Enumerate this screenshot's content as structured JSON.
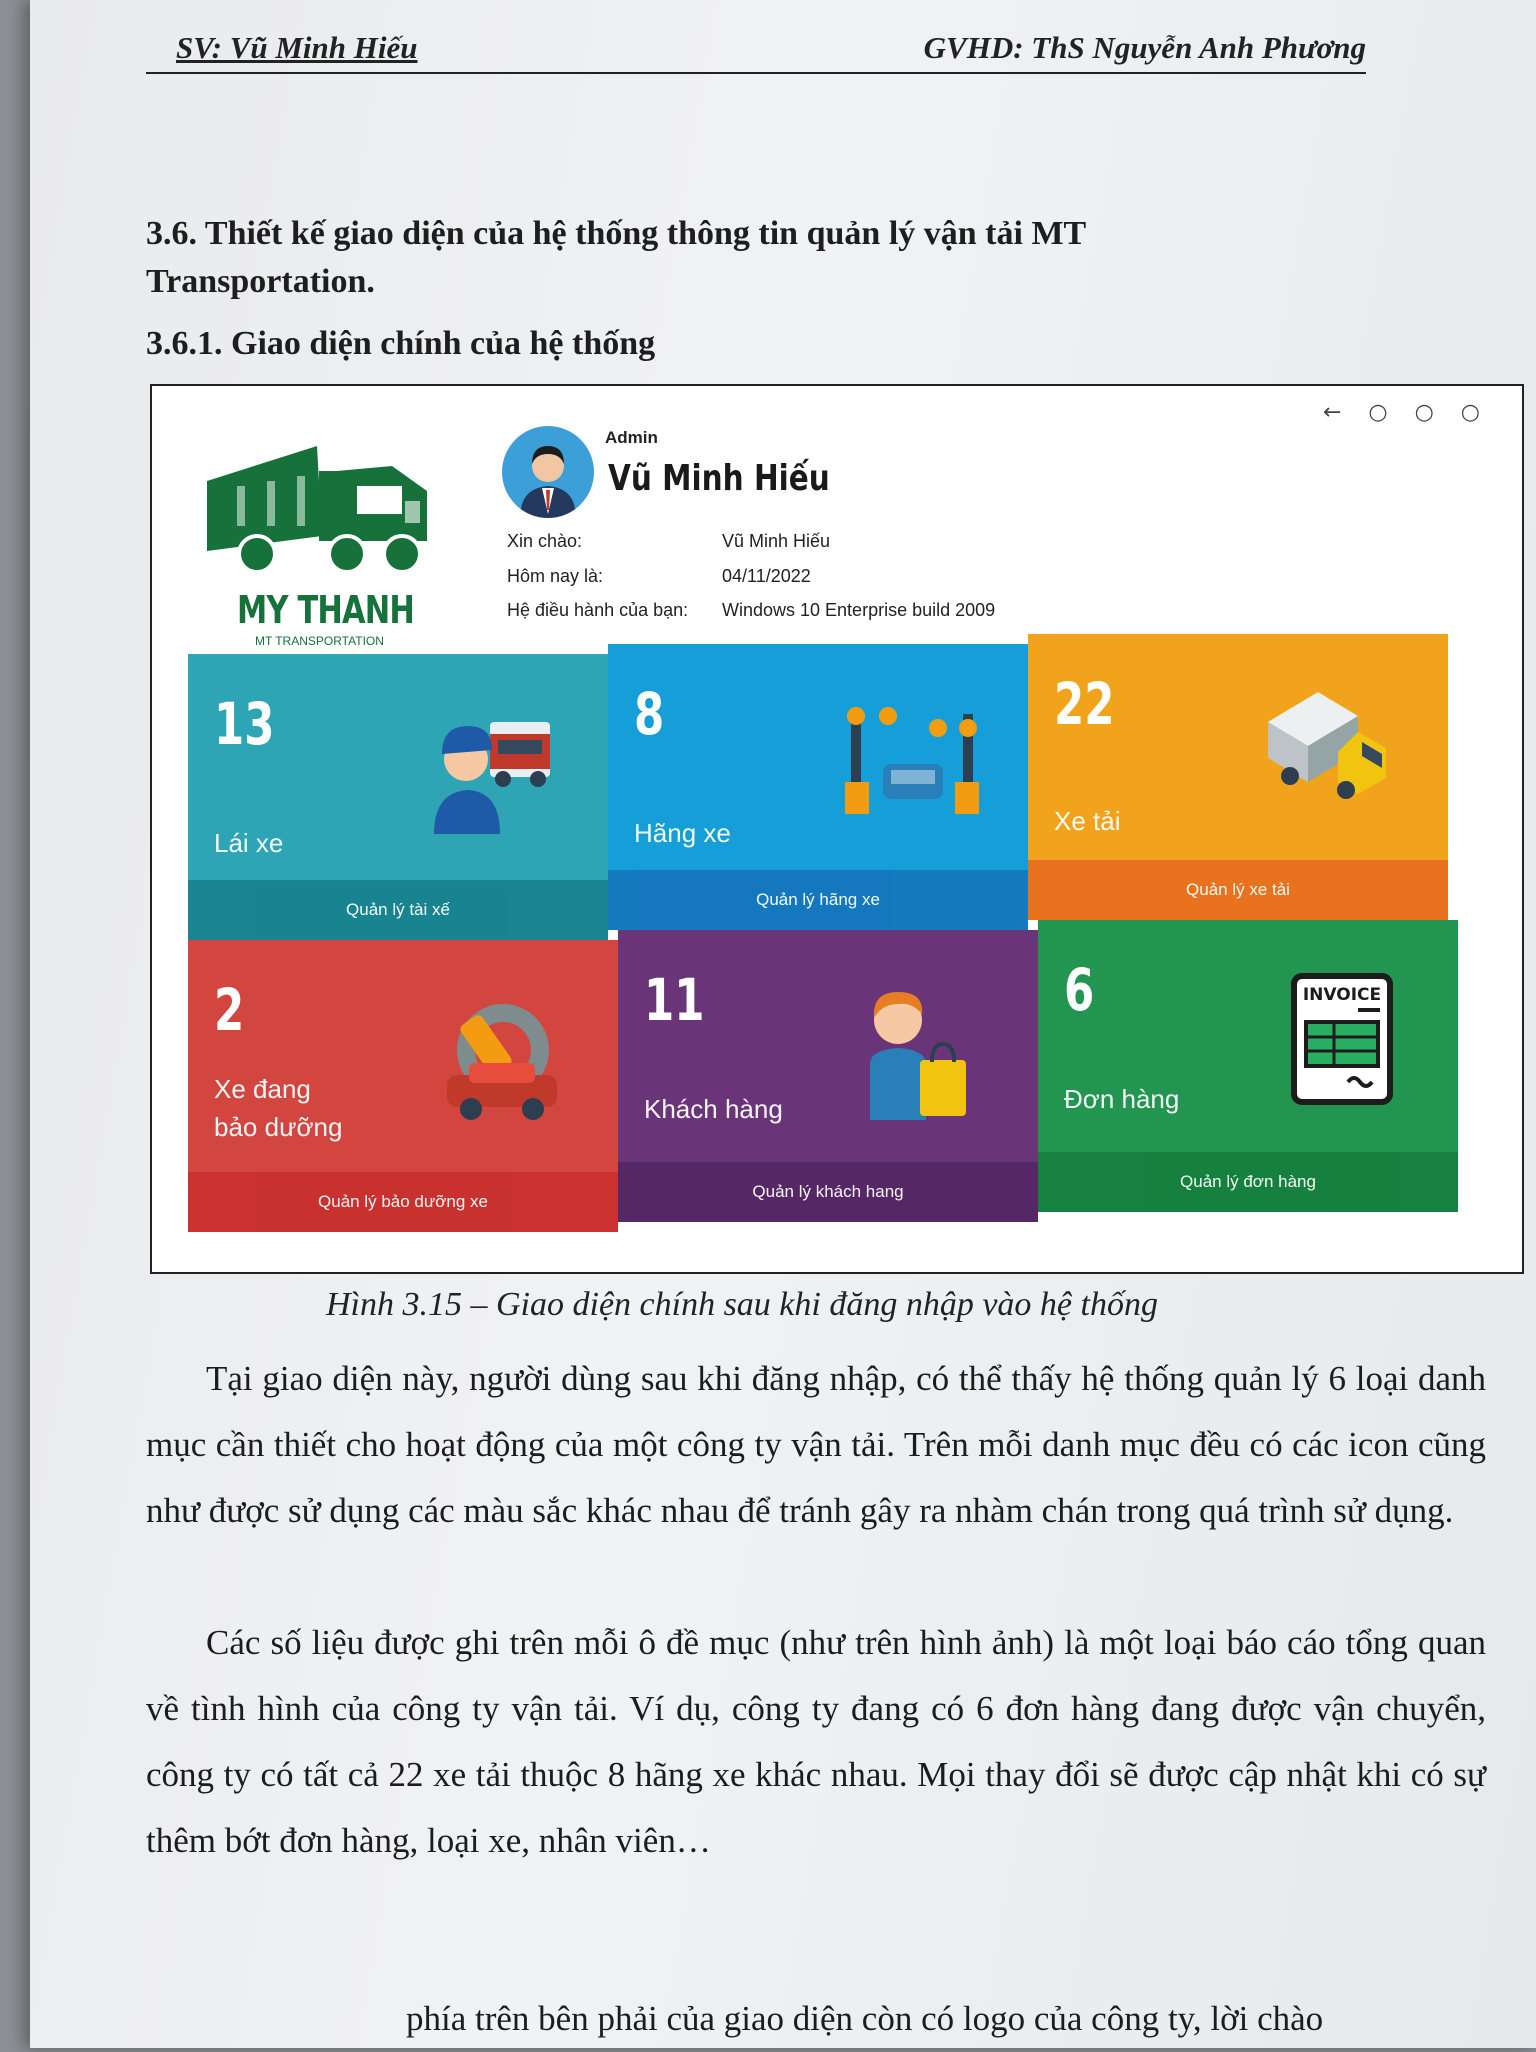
{
  "header": {
    "left": "SV: Vũ Minh Hiếu",
    "right": "GVHD: ThS Nguyễn Anh Phương"
  },
  "section_title": "3.6. Thiết kế giao diện của hệ thống thông tin quản lý vận tải MT Transportation.",
  "subsection_title": "3.6.1. Giao diện chính của hệ thống",
  "screenshot": {
    "window_controls": "← ○ ○ ○",
    "logo": {
      "brand": "MY THANH",
      "subtitle": "MT TRANSPORTATION"
    },
    "user": {
      "role": "Admin",
      "name": "Vũ Minh Hiếu"
    },
    "info": [
      {
        "label": "Xin chào:",
        "value": "Vũ Minh Hiếu"
      },
      {
        "label": "Hôm nay là:",
        "value": "04/11/2022"
      },
      {
        "label": "Hệ điều hành của bạn:",
        "value": "Windows 10 Enterprise build 2009"
      }
    ],
    "tiles": [
      {
        "count": "13",
        "label": "Lái xe",
        "link": "Quản lý tài xế",
        "icon": "driver-icon",
        "color": "#2da5b5",
        "footer_color": "#17838f"
      },
      {
        "count": "8",
        "label": "Hãng xe",
        "link": "Quản lý hãng xe",
        "icon": "car-factory-icon",
        "color": "#159ed8",
        "footer_color": "#1577bd"
      },
      {
        "count": "22",
        "label": "Xe tải",
        "link": "Quản lý xe tải",
        "icon": "truck-icon",
        "color": "#f2a31c",
        "footer_color": "#e8701f"
      },
      {
        "count": "2",
        "label": "Xe đang\nbảo dưỡng",
        "link": "Quản lý bảo dưỡng xe",
        "icon": "car-repair-icon",
        "color": "#d2463f",
        "footer_color": "#c9302e"
      },
      {
        "count": "11",
        "label": "Khách hàng",
        "link": "Quản lý khách hang",
        "icon": "customer-icon",
        "color": "#6a3479",
        "footer_color": "#552764"
      },
      {
        "count": "6",
        "label": "Đơn hàng",
        "link": "Quản lý đơn hàng",
        "icon": "invoice-icon",
        "color": "#229650",
        "footer_color": "#16803f",
        "icon_text": "INVOICE"
      }
    ]
  },
  "caption": "Hình  3.15 – Giao diện chính sau khi đăng nhập vào hệ thống",
  "paragraphs": [
    "Tại giao diện này, người dùng sau khi đăng nhập, có thể thấy hệ thống quản lý 6 loại danh mục cần thiết cho hoạt động của một công ty vận tải. Trên mỗi danh mục đều có các icon cũng như được sử dụng các màu sắc khác nhau để tránh gây ra nhàm chán trong quá trình sử dụng.",
    "Các số liệu được ghi trên mỗi ô đề mục (như trên hình ảnh) là một loại báo cáo tổng quan về tình hình của công ty vận tải. Ví dụ, công ty đang có 6 đơn hàng đang được vận chuyển, công ty có tất cả 22 xe tải thuộc 8 hãng xe khác nhau. Mọi thay đổi sẽ được cập nhật khi có sự thêm bớt đơn hàng, loại xe, nhân viên…"
  ],
  "partial_line": "phía trên bên phải của giao diện còn có logo của công ty, lời chào"
}
